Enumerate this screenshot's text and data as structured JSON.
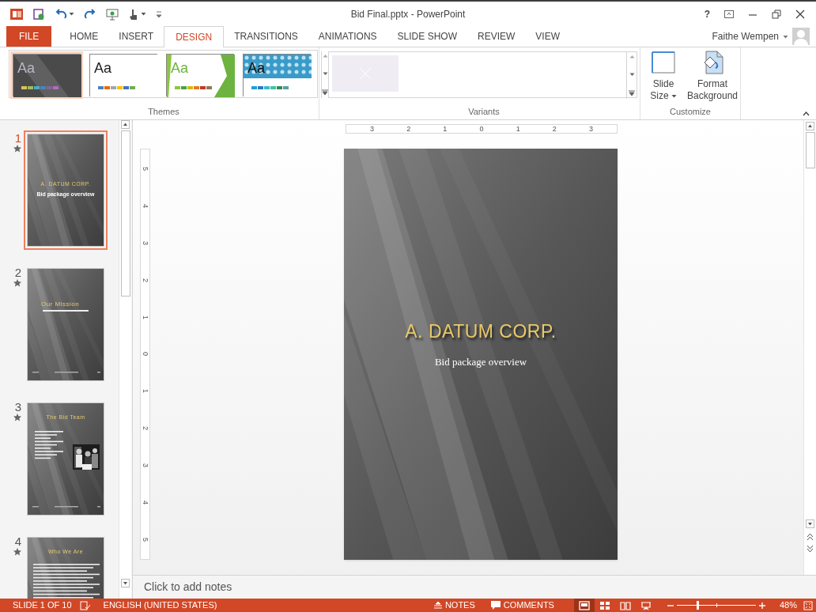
{
  "window": {
    "title": "Bid Final.pptx - PowerPoint",
    "help": "?"
  },
  "user": {
    "name": "Faithe Wempen"
  },
  "tabs": [
    {
      "label": "FILE",
      "kind": "file",
      "selected": false
    },
    {
      "label": "HOME",
      "kind": "tab",
      "selected": false
    },
    {
      "label": "INSERT",
      "kind": "tab",
      "selected": false
    },
    {
      "label": "DESIGN",
      "kind": "tab",
      "selected": true
    },
    {
      "label": "TRANSITIONS",
      "kind": "tab",
      "selected": false
    },
    {
      "label": "ANIMATIONS",
      "kind": "tab",
      "selected": false
    },
    {
      "label": "SLIDE SHOW",
      "kind": "tab",
      "selected": false
    },
    {
      "label": "REVIEW",
      "kind": "tab",
      "selected": false
    },
    {
      "label": "VIEW",
      "kind": "tab",
      "selected": false
    }
  ],
  "ribbon": {
    "themes": {
      "label": "Themes",
      "items": [
        {
          "sample": "Aa",
          "kind": "dark",
          "selected": true
        },
        {
          "sample": "Aa",
          "kind": "white",
          "selected": false
        },
        {
          "sample": "Aa",
          "kind": "green",
          "selected": false
        },
        {
          "sample": "Aa",
          "kind": "pattern",
          "selected": false
        }
      ]
    },
    "variants": {
      "label": "Variants"
    },
    "customize": {
      "label": "Customize",
      "buttons": [
        {
          "label": "Slide Size",
          "kind": "size",
          "dropdown": true
        },
        {
          "label": "Format Background",
          "kind": "background",
          "dropdown": false
        }
      ]
    }
  },
  "slides": [
    {
      "number": "1",
      "selected": true,
      "animated": true,
      "kind": "title",
      "title": "A. DATUM CORP.",
      "subtitle": "Bid package overview"
    },
    {
      "number": "2",
      "selected": false,
      "animated": true,
      "kind": "section",
      "title": "Our Mission"
    },
    {
      "number": "3",
      "selected": false,
      "animated": true,
      "title": "The Bid Team"
    },
    {
      "number": "4",
      "selected": false,
      "animated": true,
      "kind": "bullets",
      "title": "Who We Are"
    }
  ],
  "rulers": {
    "horizontal": [
      "3",
      "2",
      "1",
      "0",
      "1",
      "2",
      "3"
    ],
    "vertical": [
      "5",
      "4",
      "3",
      "2",
      "1",
      "0",
      "1",
      "2",
      "3",
      "4",
      "5"
    ]
  },
  "current_slide": {
    "title": "A. DATUM CORP.",
    "subtitle": "Bid package overview"
  },
  "notes": {
    "placeholder": "Click to add notes"
  },
  "status_bar": {
    "slide_info": "SLIDE 1 OF 10",
    "language": "ENGLISH (UNITED STATES)",
    "notes": "NOTES",
    "comments": "COMMENTS",
    "views": [
      {
        "kind": "normal",
        "selected": true
      },
      {
        "kind": "sorter",
        "selected": false
      },
      {
        "kind": "reading",
        "selected": false
      },
      {
        "kind": "slideshow",
        "selected": false
      }
    ],
    "zoom": {
      "level": 0.26,
      "reading": "48%"
    }
  }
}
